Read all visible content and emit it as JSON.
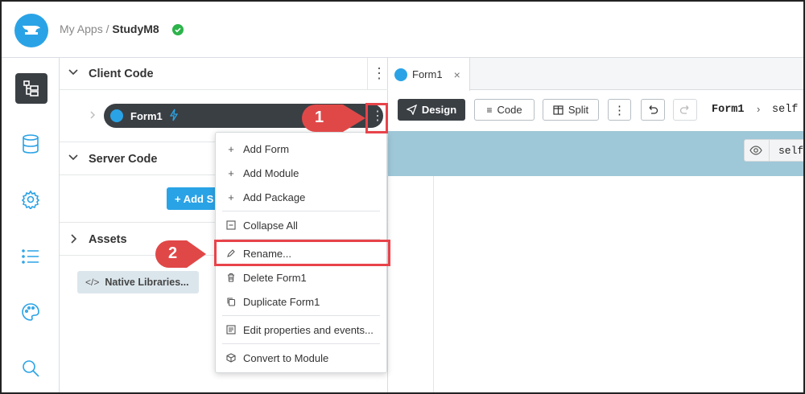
{
  "header": {
    "app_prefix": "My Apps",
    "separator": "/",
    "app_name": "StudyM8"
  },
  "rail": {
    "icons": [
      "app-tree-icon",
      "database-icon",
      "settings-icon",
      "list-icon",
      "palette-icon",
      "search-icon"
    ]
  },
  "tree": {
    "client_code": "Client Code",
    "form_item": "Form1",
    "server_code": "Server Code",
    "add_server_button": "+ Add S",
    "assets": "Assets",
    "native_libraries": "Native Libraries..."
  },
  "editor": {
    "tab_label": "Form1",
    "tab_close": "×",
    "design": "Design",
    "code": "Code",
    "split": "Split",
    "more": "⋮",
    "crumb_form": "Form1",
    "crumb_sep": "›",
    "crumb_self": "self",
    "strip_code": "self"
  },
  "context_menu": {
    "items": [
      "Add Form",
      "Add Module",
      "Add Package",
      "Collapse All",
      "Rename...",
      "Delete Form1",
      "Duplicate Form1",
      "Edit properties and events...",
      "Convert to Module"
    ]
  },
  "callouts": {
    "one": "1",
    "two": "2"
  },
  "colors": {
    "accent": "#2aa3e6",
    "highlight": "#e8434a",
    "strip": "#9ec7d7",
    "dark_button": "#3a3f44"
  }
}
